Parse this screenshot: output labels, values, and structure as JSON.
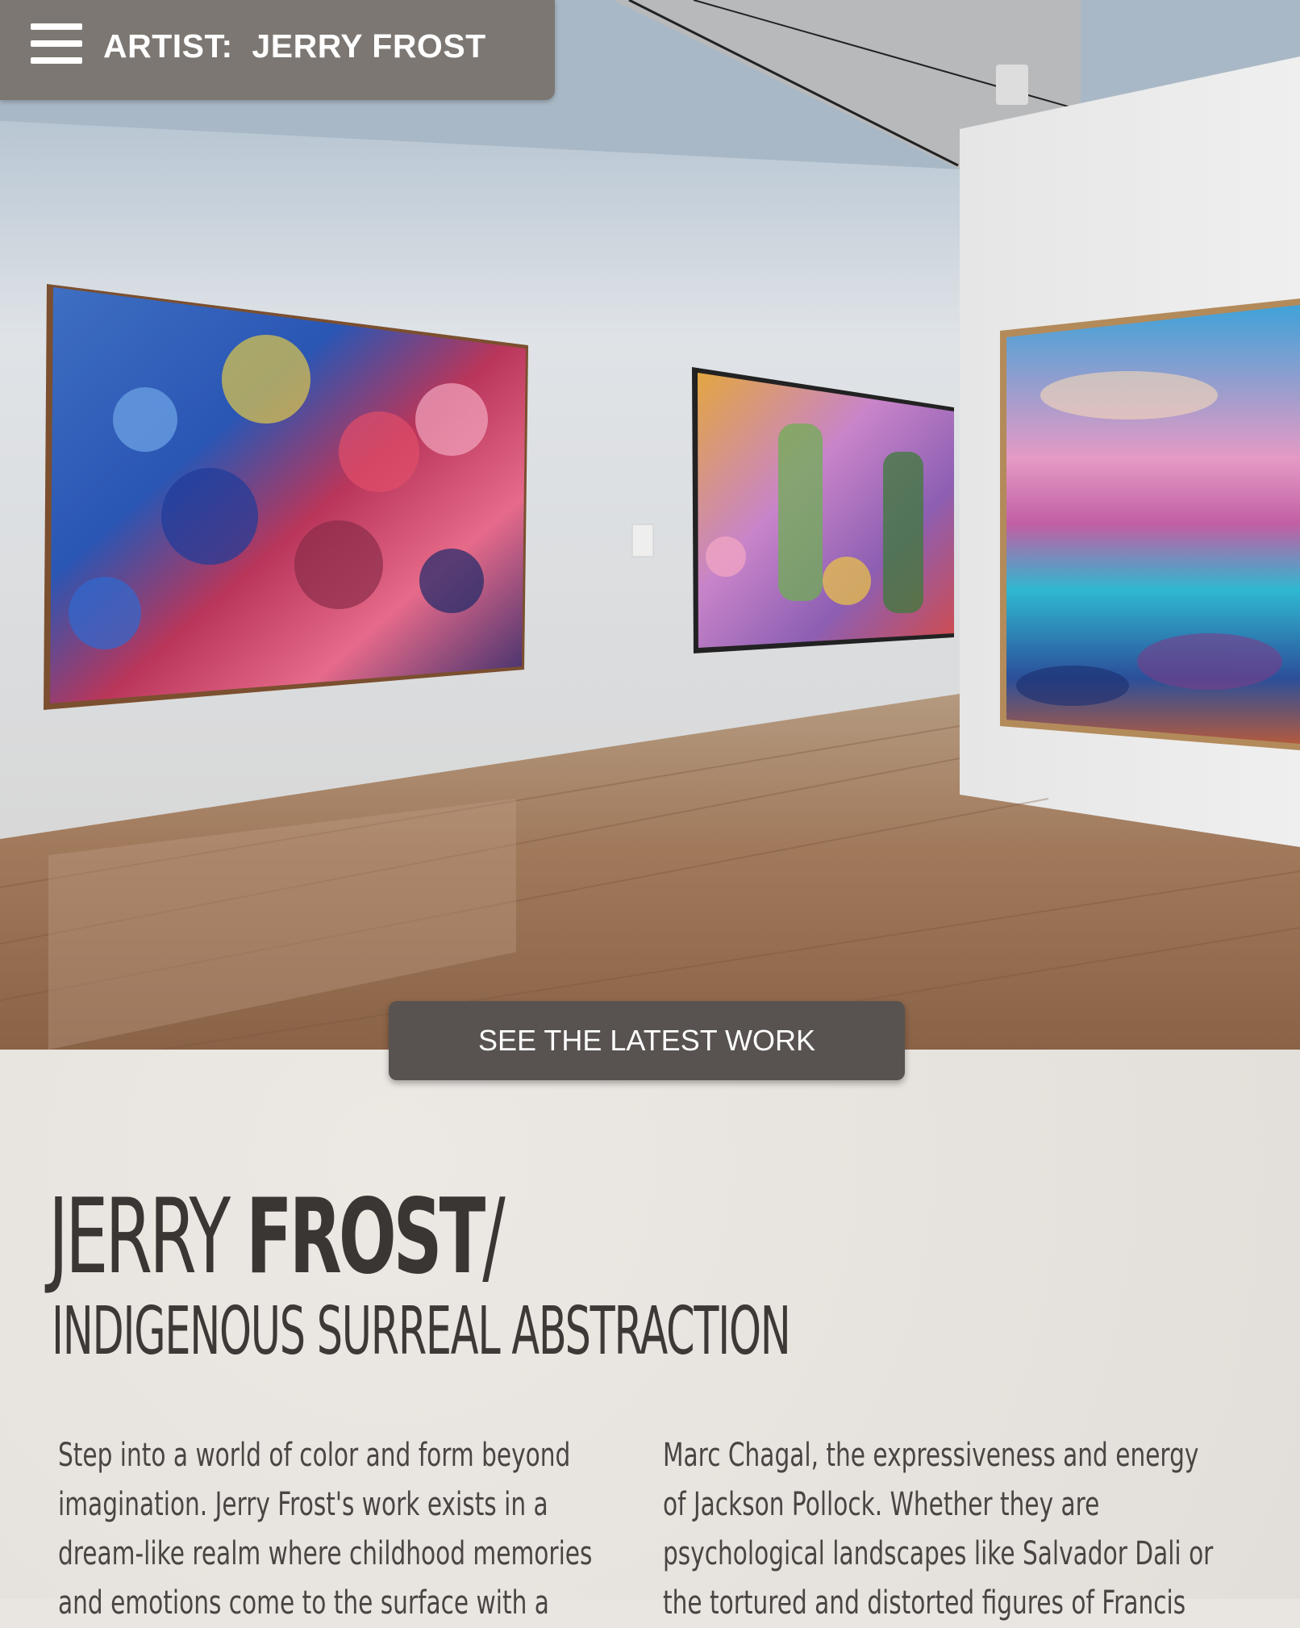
{
  "header": {
    "menu_icon": "hamburger-menu-icon",
    "artist_label": "ARTIST:  JERRY FROST"
  },
  "hero": {
    "cta_label": "SEE THE LATEST WORK"
  },
  "intro": {
    "name_light": "JERRY ",
    "name_bold": "FROST",
    "slash": "/",
    "subtitle": "INDIGENOUS SURREAL ABSTRACTION",
    "col1": [
      "Step into a world of color and form beyond",
      "imagination. Jerry Frost's work exists in a",
      "dream-like realm where childhood memories",
      "and emotions come to the surface with a"
    ],
    "col2": [
      "Marc Chagal, the expressiveness and energy",
      "of Jackson Pollock. Whether they are",
      "psychological landscapes like Salvador Dali or",
      "the tortured and distorted figures of Francis"
    ]
  },
  "colors": {
    "header_bg": "#7c7772",
    "cta_bg": "#585350",
    "heading_text": "#3a3633",
    "body_text": "#4a4542"
  }
}
